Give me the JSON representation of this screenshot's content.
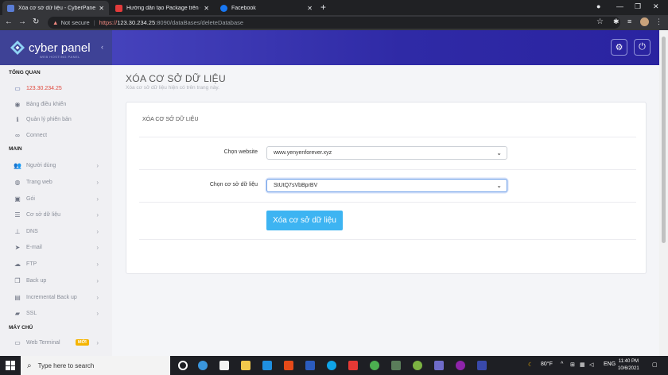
{
  "browser": {
    "tabs": [
      {
        "title": "Xóa cơ sở dữ liệu - CyberPanel",
        "active": true
      },
      {
        "title": "Hướng dẫn tạo Package trên Cy",
        "active": false
      },
      {
        "title": "Facebook",
        "active": false
      }
    ],
    "not_secure": "Not secure",
    "url_scheme": "https://",
    "url_host": "123.30.234.25",
    "url_path": ":8090/dataBases/deleteDatabase"
  },
  "header": {
    "logo_text": "cyber panel",
    "logo_sub": "WEB HOSTING PANEL"
  },
  "sidebar": {
    "sections": [
      "TỔNG QUAN",
      "MAIN",
      "MÁY CHỦ"
    ],
    "overview_items": [
      {
        "label": "123.30.234.25",
        "icon": "monitor-icon"
      },
      {
        "label": "Bảng điều khiển",
        "icon": "dashboard-icon"
      },
      {
        "label": "Quản lý phiên bản",
        "icon": "info-icon"
      },
      {
        "label": "Connect",
        "icon": "link-icon"
      }
    ],
    "main_items": [
      {
        "label": "Người dùng",
        "icon": "users-icon"
      },
      {
        "label": "Trang web",
        "icon": "globe-icon"
      },
      {
        "label": "Gói",
        "icon": "cubes-icon"
      },
      {
        "label": "Cơ sở dữ liệu",
        "icon": "database-icon"
      },
      {
        "label": "DNS",
        "icon": "sitemap-icon"
      },
      {
        "label": "E-mail",
        "icon": "paper-plane-icon"
      },
      {
        "label": "FTP",
        "icon": "cloud-upload-icon"
      },
      {
        "label": "Back up",
        "icon": "copy-icon"
      },
      {
        "label": "Incremental Back up",
        "icon": "save-icon"
      },
      {
        "label": "SSL",
        "icon": "lock-icon"
      }
    ],
    "server_items": [
      {
        "label": "Web Terminal",
        "icon": "terminal-icon",
        "badge": "MỚI"
      }
    ]
  },
  "main": {
    "title": "XÓA CƠ SỞ DỮ LIỆU",
    "subtitle": "Xóa cơ sở dữ liệu hiện có trên trang này.",
    "card_title": "XÓA CƠ SỞ DỮ LIỆU",
    "website_label": "Chọn website",
    "website_value": "www.yenyenforever.xyz",
    "db_label": "Chọn cơ sở dữ liệu",
    "db_value": "StUtQ7sVbBprBV",
    "delete_button": "Xóa cơ sở dữ liệu"
  },
  "taskbar": {
    "search_placeholder": "Type here to search",
    "weather": "80°F",
    "lang": "ENG",
    "time": "11:40 PM",
    "date": "10/6/2021"
  },
  "colors": {
    "header_gradient_start": "#4e4cc4",
    "header_gradient_end": "#2a23a0",
    "button_primary": "#3db4f2",
    "active_ip": "#e0473b",
    "badge_new": "#f5b400"
  }
}
